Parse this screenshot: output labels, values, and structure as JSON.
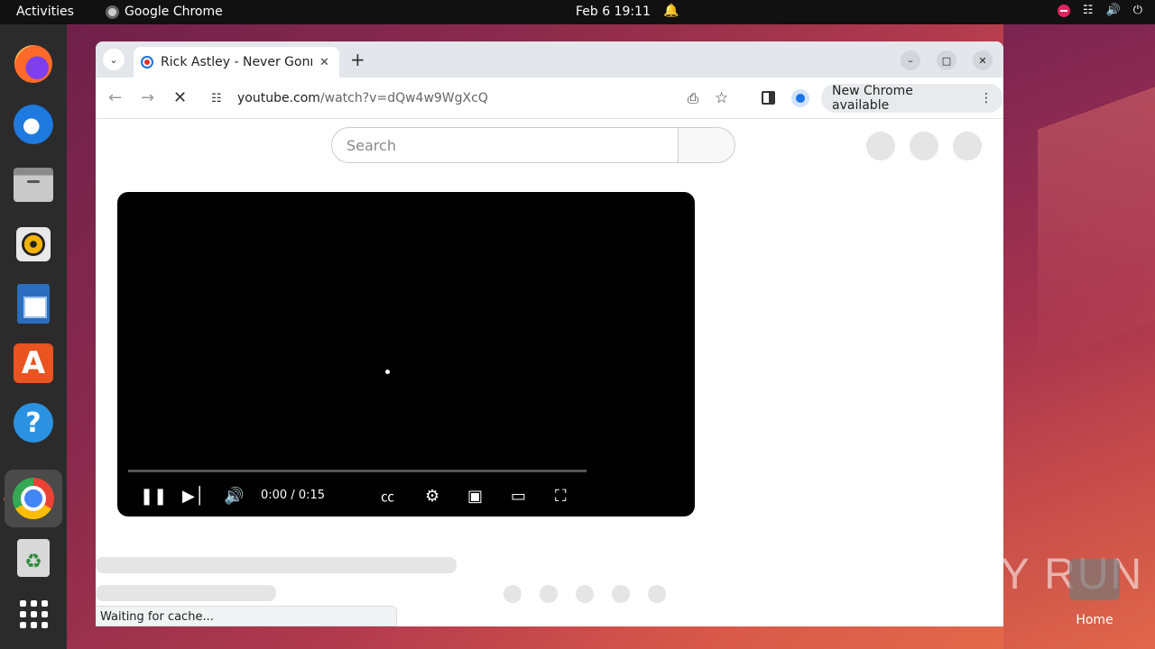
{
  "topbar": {
    "activities": "Activities",
    "app_name": "Google Chrome",
    "clock": "Feb 6  19:11"
  },
  "dock": {
    "items": [
      "Firefox",
      "Thunderbird",
      "Files",
      "Rhythmbox",
      "LibreOffice Writer",
      "Ubuntu Software",
      "Help",
      "Google Chrome",
      "Trash",
      "Show Applications"
    ]
  },
  "browser": {
    "tab": {
      "title": "Rick Astley - Never Gonna Give You Up"
    },
    "url": {
      "host": "youtube.com",
      "path": "/watch?v=dQw4w9WgXcQ"
    },
    "update_label": "New Chrome available"
  },
  "page": {
    "search_placeholder": "Search",
    "player": {
      "time": "0:00 / 0:15",
      "progress": 0
    },
    "status": "Waiting for cache..."
  },
  "desktop": {
    "watermark": "ANY RUN",
    "home_label": "Home"
  },
  "colors": {
    "accent": "#e95420",
    "page_bg": "#ffffff",
    "player_bg": "#000000"
  }
}
